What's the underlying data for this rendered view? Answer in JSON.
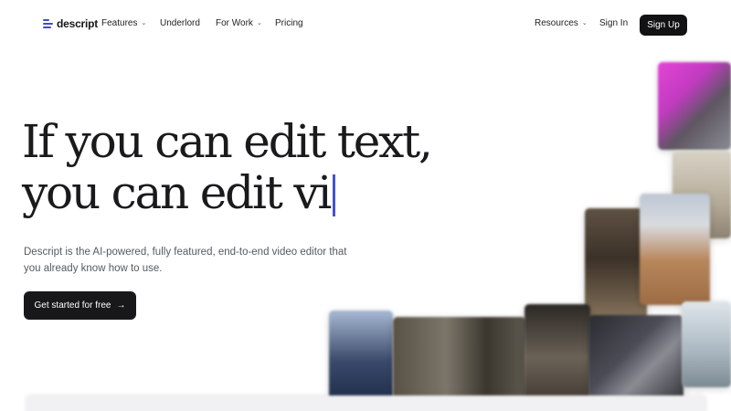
{
  "brand": {
    "name": "descript",
    "accent": "#3f4cc9"
  },
  "nav": {
    "features": "Features",
    "underlord": "Underlord",
    "for_work": "For Work",
    "pricing": "Pricing",
    "resources": "Resources",
    "sign_in": "Sign In",
    "sign_up": "Sign Up",
    "chevron_icon": "chevron-down-icon"
  },
  "hero": {
    "headline_line1": "If you can edit text,",
    "headline_line2": "you can edit vi",
    "subcopy": "Descript is the AI-powered, fully featured, end-to-end video editor that you already know how to use.",
    "cta_label": "Get started for free",
    "cta_icon": "→",
    "cursor_color": "#4453cf"
  }
}
